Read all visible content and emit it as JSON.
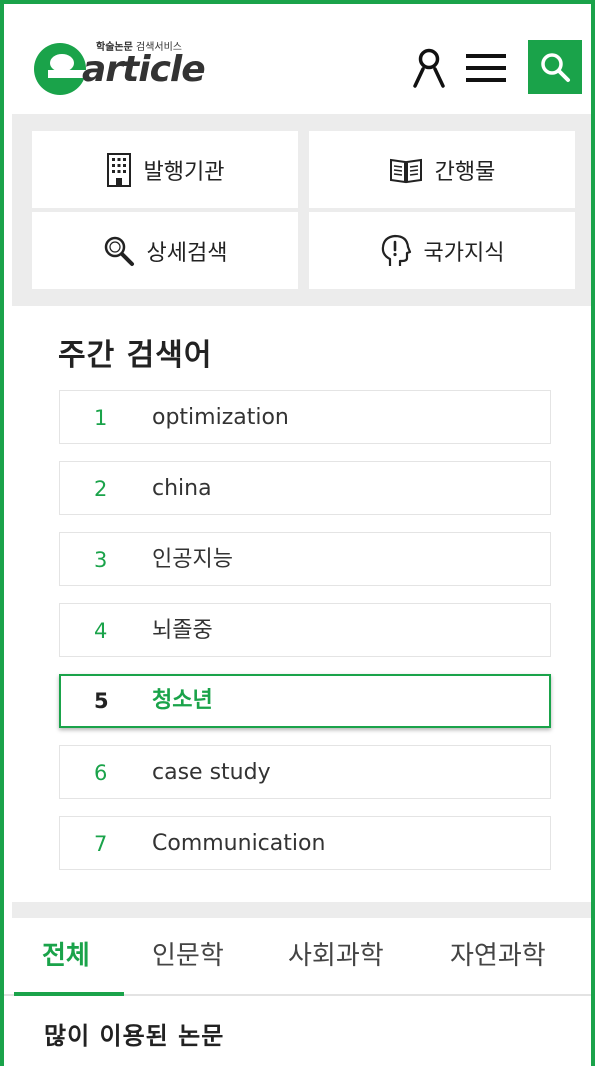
{
  "header": {
    "logo_tagline_bold": "학술논문",
    "logo_tagline": "검색서비스",
    "logo_word": "article",
    "logo_letter": "e",
    "brand_color": "#1aa34a",
    "icons": [
      "user-icon",
      "menu-icon",
      "search-icon"
    ]
  },
  "quick_menu": {
    "items": [
      {
        "label": "발행기관",
        "icon": "building-icon"
      },
      {
        "label": "간행물",
        "icon": "book-icon"
      },
      {
        "label": "상세검색",
        "icon": "magnifier-icon"
      },
      {
        "label": "국가지식",
        "icon": "head-question-icon"
      }
    ]
  },
  "weekly": {
    "title": "주간 검색어",
    "keywords": [
      {
        "rank": "1",
        "term": "optimization"
      },
      {
        "rank": "2",
        "term": "china"
      },
      {
        "rank": "3",
        "term": "인공지능"
      },
      {
        "rank": "4",
        "term": "뇌졸중"
      },
      {
        "rank": "5",
        "term": "청소년",
        "active": true
      },
      {
        "rank": "6",
        "term": "case study"
      },
      {
        "rank": "7",
        "term": "Communication"
      }
    ]
  },
  "tabs": {
    "items": [
      "전체",
      "인문학",
      "사회과학",
      "자연과학"
    ],
    "active": "전체"
  },
  "popular": {
    "title": "많이 이용된 논문"
  }
}
